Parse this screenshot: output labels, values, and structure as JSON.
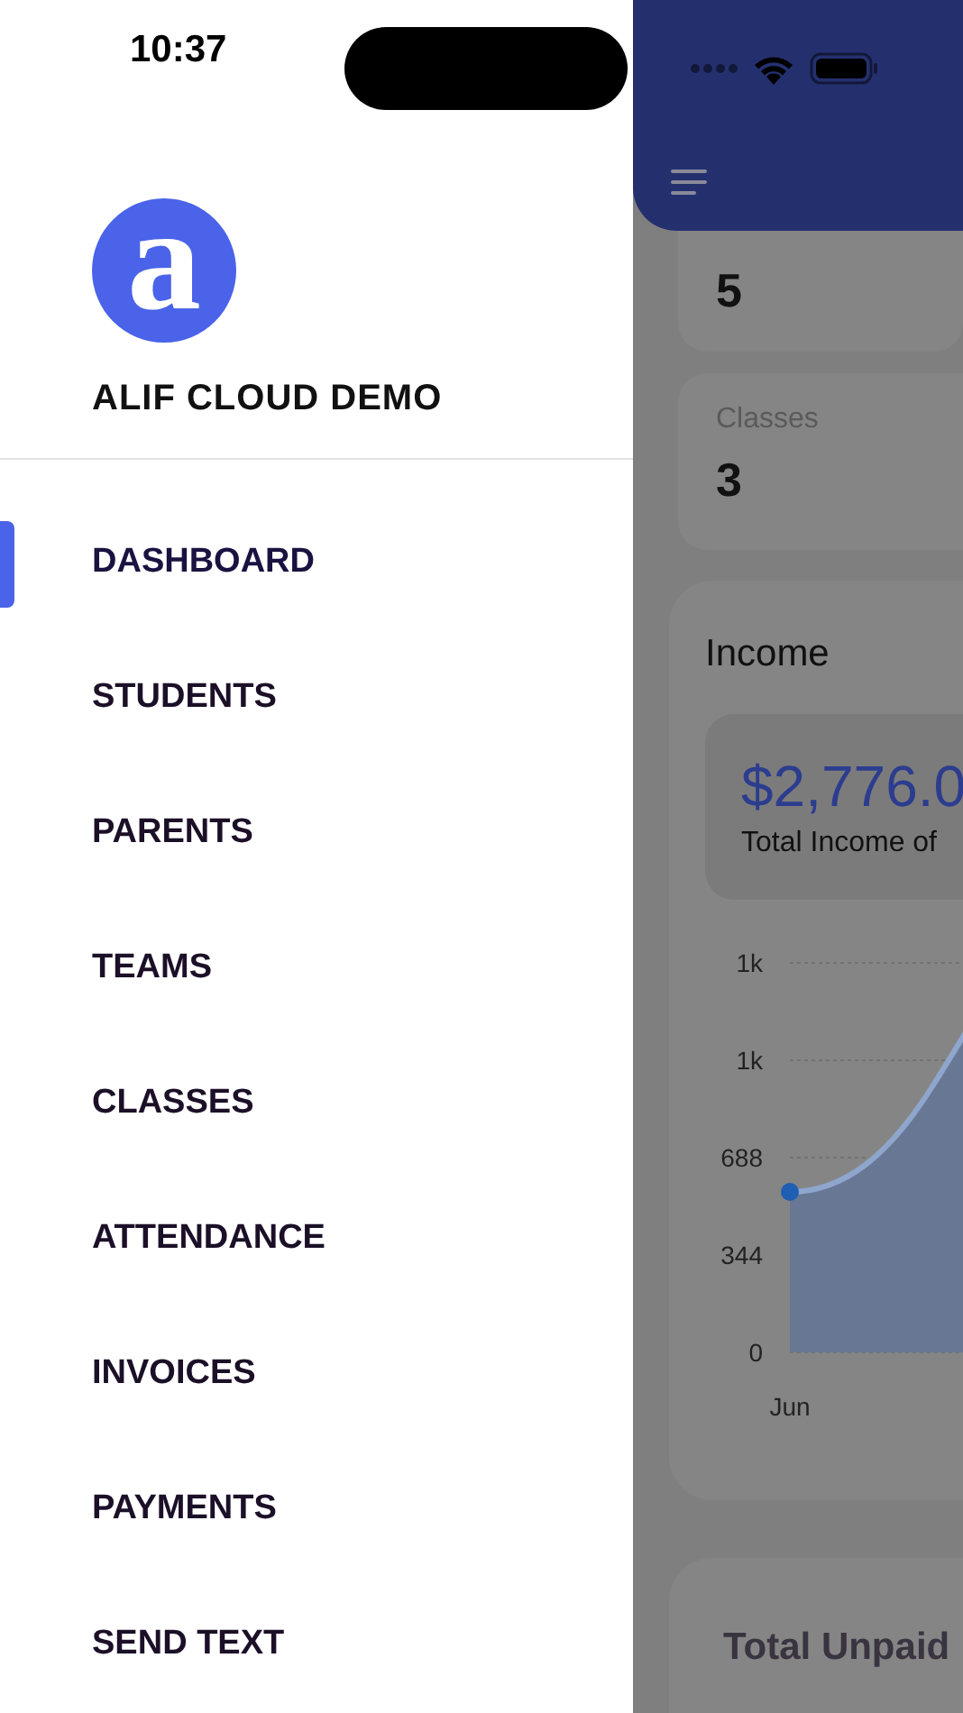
{
  "status_bar": {
    "time": "10:37"
  },
  "drawer": {
    "logo": {
      "letter": "a"
    },
    "title": "ALIF CLOUD DEMO",
    "items": [
      {
        "label": "DASHBOARD",
        "selected": true
      },
      {
        "label": "STUDENTS",
        "selected": false
      },
      {
        "label": "PARENTS",
        "selected": false
      },
      {
        "label": "TEAMS",
        "selected": false
      },
      {
        "label": "CLASSES",
        "selected": false
      },
      {
        "label": "ATTENDANCE",
        "selected": false
      },
      {
        "label": "INVOICES",
        "selected": false
      },
      {
        "label": "PAYMENTS",
        "selected": false
      },
      {
        "label": "SEND TEXT",
        "selected": false
      }
    ]
  },
  "stats": [
    {
      "value": "5"
    },
    {
      "label": "Classes",
      "value": "3"
    }
  ],
  "income": {
    "title": "Income",
    "amount": "$2,776.0",
    "caption": "Total Income of",
    "chart": {
      "y_labels": [
        "1k",
        "1k",
        "688",
        "344",
        "0"
      ],
      "x_labels": [
        "Jun"
      ]
    }
  },
  "unpaid": {
    "title": "Total Unpaid"
  }
}
